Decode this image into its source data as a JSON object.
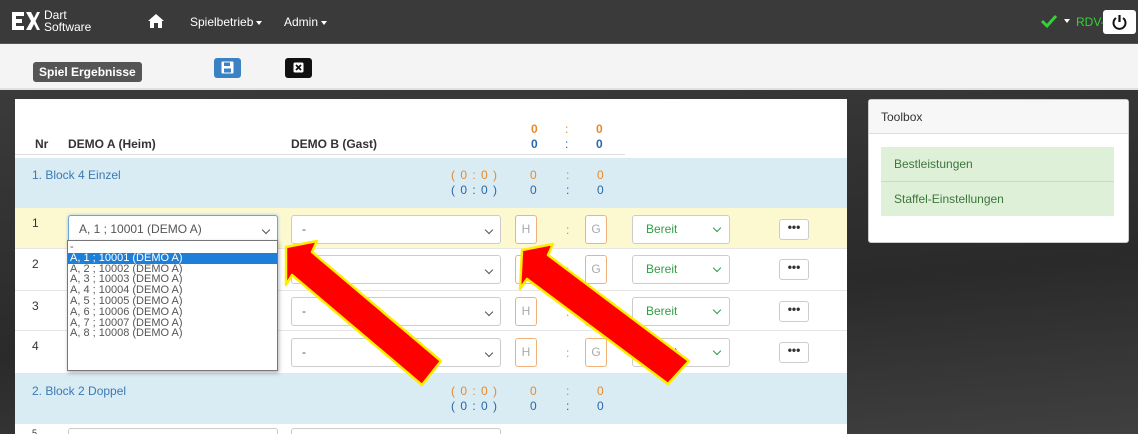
{
  "navbar": {
    "logo_line1": "Dart",
    "logo_line2": "Software",
    "menu": [
      "Spielbetrieb",
      "Admin"
    ],
    "user": "RDV-F",
    "icons": [
      "home-icon",
      "check-icon",
      "power-icon"
    ]
  },
  "toolbar": {
    "page_title": "Spiel Ergebnisse",
    "icons": [
      "save-icon",
      "close-icon"
    ]
  },
  "table": {
    "col_nr": "Nr",
    "col_home": "DEMO A (Heim)",
    "col_guest": "DEMO B (Gast)",
    "total": {
      "home_orange": "0",
      "guest_orange": "0",
      "home_blue": "0",
      "guest_blue": "0",
      "sep": ":"
    }
  },
  "blocks": [
    {
      "title": "1. Block 4 Einzel",
      "sub1": "( 0 : 0 )",
      "sub2": "( 0 : 0 )",
      "o_home": "0",
      "o_guest": "0",
      "b_home": "0",
      "b_guest": "0"
    },
    {
      "title": "2. Block 2 Doppel",
      "sub1": "( 0 : 0 )",
      "sub2": "( 0 : 0 )",
      "o_home": "0",
      "o_guest": "0",
      "b_home": "0",
      "b_guest": "0"
    }
  ],
  "rows": [
    {
      "nr": "1",
      "home": "A, 1 ; 10001 (DEMO A)",
      "guest": "-",
      "h": "H",
      "g": "G",
      "status": "Bereit",
      "more": "•••"
    },
    {
      "nr": "2",
      "home": "",
      "guest": "-",
      "h": "H",
      "g": "G",
      "status": "Bereit",
      "more": "•••"
    },
    {
      "nr": "3",
      "home": "",
      "guest": "-",
      "h": "H",
      "g": "G",
      "status": "Bereit",
      "more": "•••"
    },
    {
      "nr": "4",
      "home": "",
      "guest": "-",
      "h": "H",
      "g": "G",
      "status": "Bereit",
      "more": "•••"
    },
    {
      "nr": "5"
    }
  ],
  "dropdown_options": [
    "-",
    "A, 1 ; 10001 (DEMO A)",
    "A, 2 ; 10002 (DEMO A)",
    "A, 3 ; 10003 (DEMO A)",
    "A, 4 ; 10004 (DEMO A)",
    "A, 5 ; 10005 (DEMO A)",
    "A, 6 ; 10006 (DEMO A)",
    "A, 7 ; 10007 (DEMO A)",
    "A, 8 ; 10008 (DEMO A)"
  ],
  "toolbox": {
    "title": "Toolbox",
    "items": [
      "Bestleistungen",
      "Staffel-Einstellungen"
    ]
  },
  "colors": {
    "navbar": "#3a3a3a",
    "accent_blue": "#3a82c4",
    "score_orange": "#e8892b",
    "status_green": "#2f9e44",
    "user_green": "#35d235",
    "annotation_arrow": "#ff0000",
    "annotation_outline": "#ffee00"
  }
}
